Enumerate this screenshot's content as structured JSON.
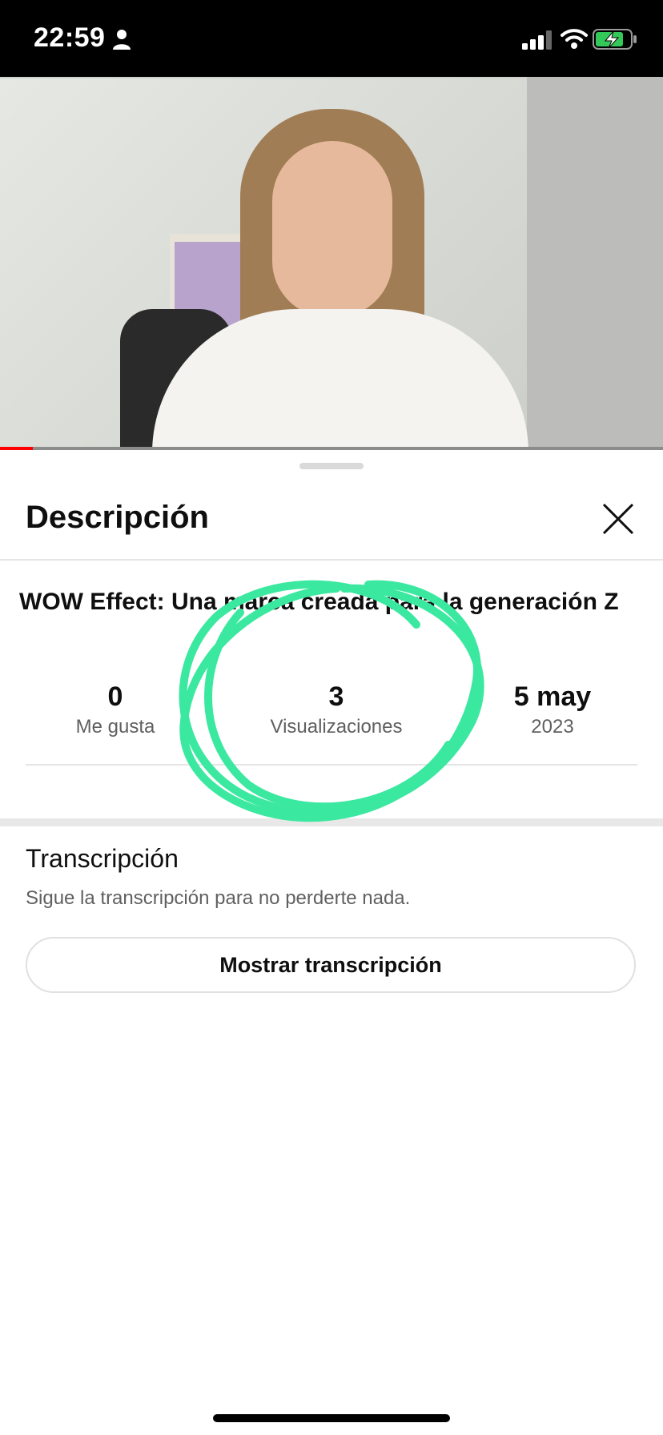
{
  "status_bar": {
    "time": "22:59"
  },
  "video": {
    "progress_fraction": 0.05
  },
  "sheet": {
    "title": "Descripción",
    "video_title": "WOW Effect: Una marca creada para la generación Z",
    "stats": {
      "likes_value": "0",
      "likes_label": "Me gusta",
      "views_value": "3",
      "views_label": "Visualizaciones",
      "date_value": "5 may",
      "date_year": "2023"
    },
    "transcript": {
      "title": "Transcripción",
      "description": "Sigue la transcripción para no perderte nada.",
      "button_label": "Mostrar transcripción"
    }
  },
  "colors": {
    "annotation": "#3be8a0",
    "progress": "#ff0000",
    "battery": "#34c759"
  },
  "icons": [
    "person-icon",
    "signal-icon",
    "wifi-icon",
    "battery-charging-icon",
    "close-icon"
  ]
}
